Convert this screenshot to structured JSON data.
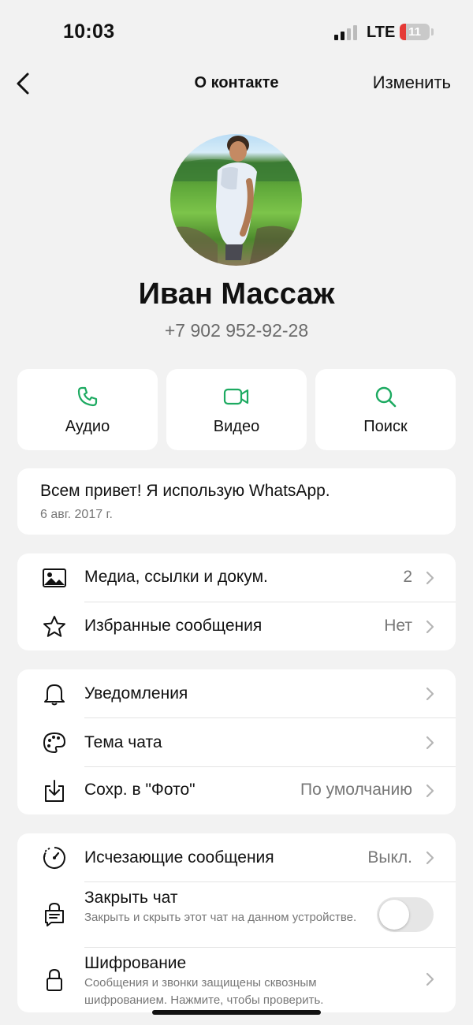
{
  "status_bar": {
    "time": "10:03",
    "network": "LTE",
    "battery_level": "11",
    "battery_fraction": 0.11,
    "signal_bars": 2
  },
  "nav": {
    "title": "О контакте",
    "edit_label": "Изменить"
  },
  "contact": {
    "name": "Иван Массаж",
    "phone": "+7 902 952-92-28"
  },
  "actions": [
    {
      "label": "Аудио",
      "icon": "phone-icon"
    },
    {
      "label": "Видео",
      "icon": "video-icon"
    },
    {
      "label": "Поиск",
      "icon": "search-icon"
    }
  ],
  "about": {
    "text": "Всем привет! Я использую WhatsApp.",
    "date": "6 авг. 2017 г."
  },
  "media_section": {
    "rows": [
      {
        "label": "Медиа, ссылки и докум.",
        "value": "2",
        "icon": "image-icon"
      },
      {
        "label": "Избранные сообщения",
        "value": "Нет",
        "icon": "star-icon"
      }
    ]
  },
  "settings_section": {
    "rows": [
      {
        "label": "Уведомления",
        "icon": "bell-icon"
      },
      {
        "label": "Тема чата",
        "icon": "palette-icon"
      },
      {
        "label": "Сохр. в \"Фото\"",
        "value": "По умолчанию",
        "icon": "download-icon"
      }
    ]
  },
  "privacy_section": {
    "disappearing": {
      "label": "Исчезающие сообщения",
      "value": "Выкл.",
      "icon": "timer-icon"
    },
    "lock_chat": {
      "label": "Закрыть чат",
      "description": "Закрыть и скрыть этот чат на данном устройстве.",
      "enabled": false,
      "icon": "lock-chat-icon"
    },
    "encryption": {
      "label": "Шифрование",
      "description": "Сообщения и звонки защищены сквозным шифрованием. Нажмите, чтобы проверить.",
      "icon": "lock-icon"
    }
  },
  "colors": {
    "accent_green": "#1DAA61",
    "background": "#f2f2f2",
    "battery_low": "#e53935"
  }
}
